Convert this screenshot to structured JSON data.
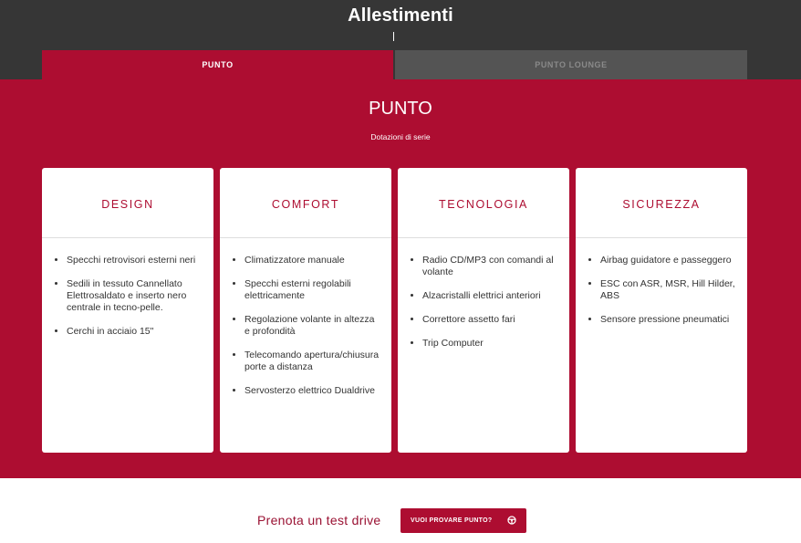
{
  "page": {
    "title": "Allestimenti"
  },
  "tabs": [
    {
      "label": "PUNTO",
      "active": true
    },
    {
      "label": "PUNTO LOUNGE",
      "active": false
    }
  ],
  "section": {
    "title": "PUNTO",
    "subtitle": "Dotazioni di serie"
  },
  "cards": [
    {
      "title": "DESIGN",
      "items": [
        "Specchi retrovisori esterni neri",
        "Sedili in tessuto Cannellato Elettrosaldato e inserto nero centrale in tecno-pelle.",
        "Cerchi in acciaio 15\""
      ]
    },
    {
      "title": "COMFORT",
      "items": [
        "Climatizzatore manuale",
        "Specchi esterni regolabili elettricamente",
        "Regolazione volante in altezza e profondità",
        "Telecomando apertura/chiusura porte a distanza",
        "Servosterzo elettrico Dualdrive"
      ]
    },
    {
      "title": "TECNOLOGIA",
      "items": [
        "Radio CD/MP3 con comandi al volante",
        "Alzacristalli elettrici anteriori",
        "Correttore assetto fari",
        "Trip Computer"
      ]
    },
    {
      "title": "SICUREZZA",
      "items": [
        "Airbag guidatore e passeggero",
        "ESC con ASR, MSR, Hill Hilder, ABS",
        "Sensore pressione pneumatici"
      ]
    }
  ],
  "cta": {
    "text": "Prenota un test drive",
    "button_label": "VUOI PROVARE PUNTO?",
    "button_icon": "steering-wheel-icon"
  },
  "colors": {
    "brand": "#ad0d31",
    "header_bg": "#363636",
    "inactive_tab": "#545454"
  }
}
